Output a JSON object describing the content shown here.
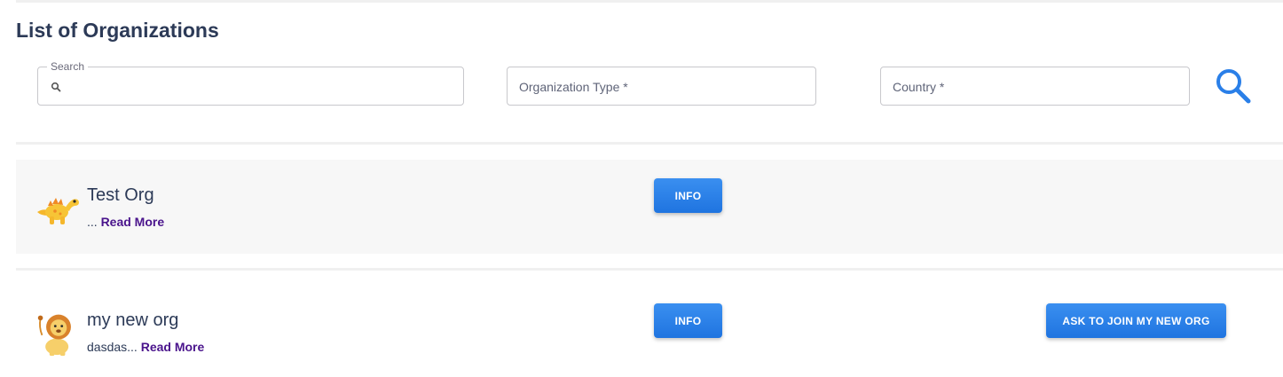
{
  "page": {
    "title": "List of Organizations"
  },
  "filters": {
    "search_label": "Search",
    "search_value": "",
    "organization_type_placeholder": "Organization Type *",
    "country_placeholder": "Country *"
  },
  "colors": {
    "accent": "#2a7fe8",
    "title": "#2c3a57",
    "read_more": "#4a148c",
    "row_shade": "#f7f7f7"
  },
  "organizations": [
    {
      "name": "Test Org",
      "description": "...",
      "read_more": "Read More",
      "info_label": "INFO",
      "avatar_icon": "dinosaur-icon"
    },
    {
      "name": "my new org",
      "description": "dasdas...",
      "read_more": "Read More",
      "info_label": "INFO",
      "join_label": "ASK TO JOIN MY NEW ORG",
      "avatar_icon": "lion-icon"
    }
  ]
}
